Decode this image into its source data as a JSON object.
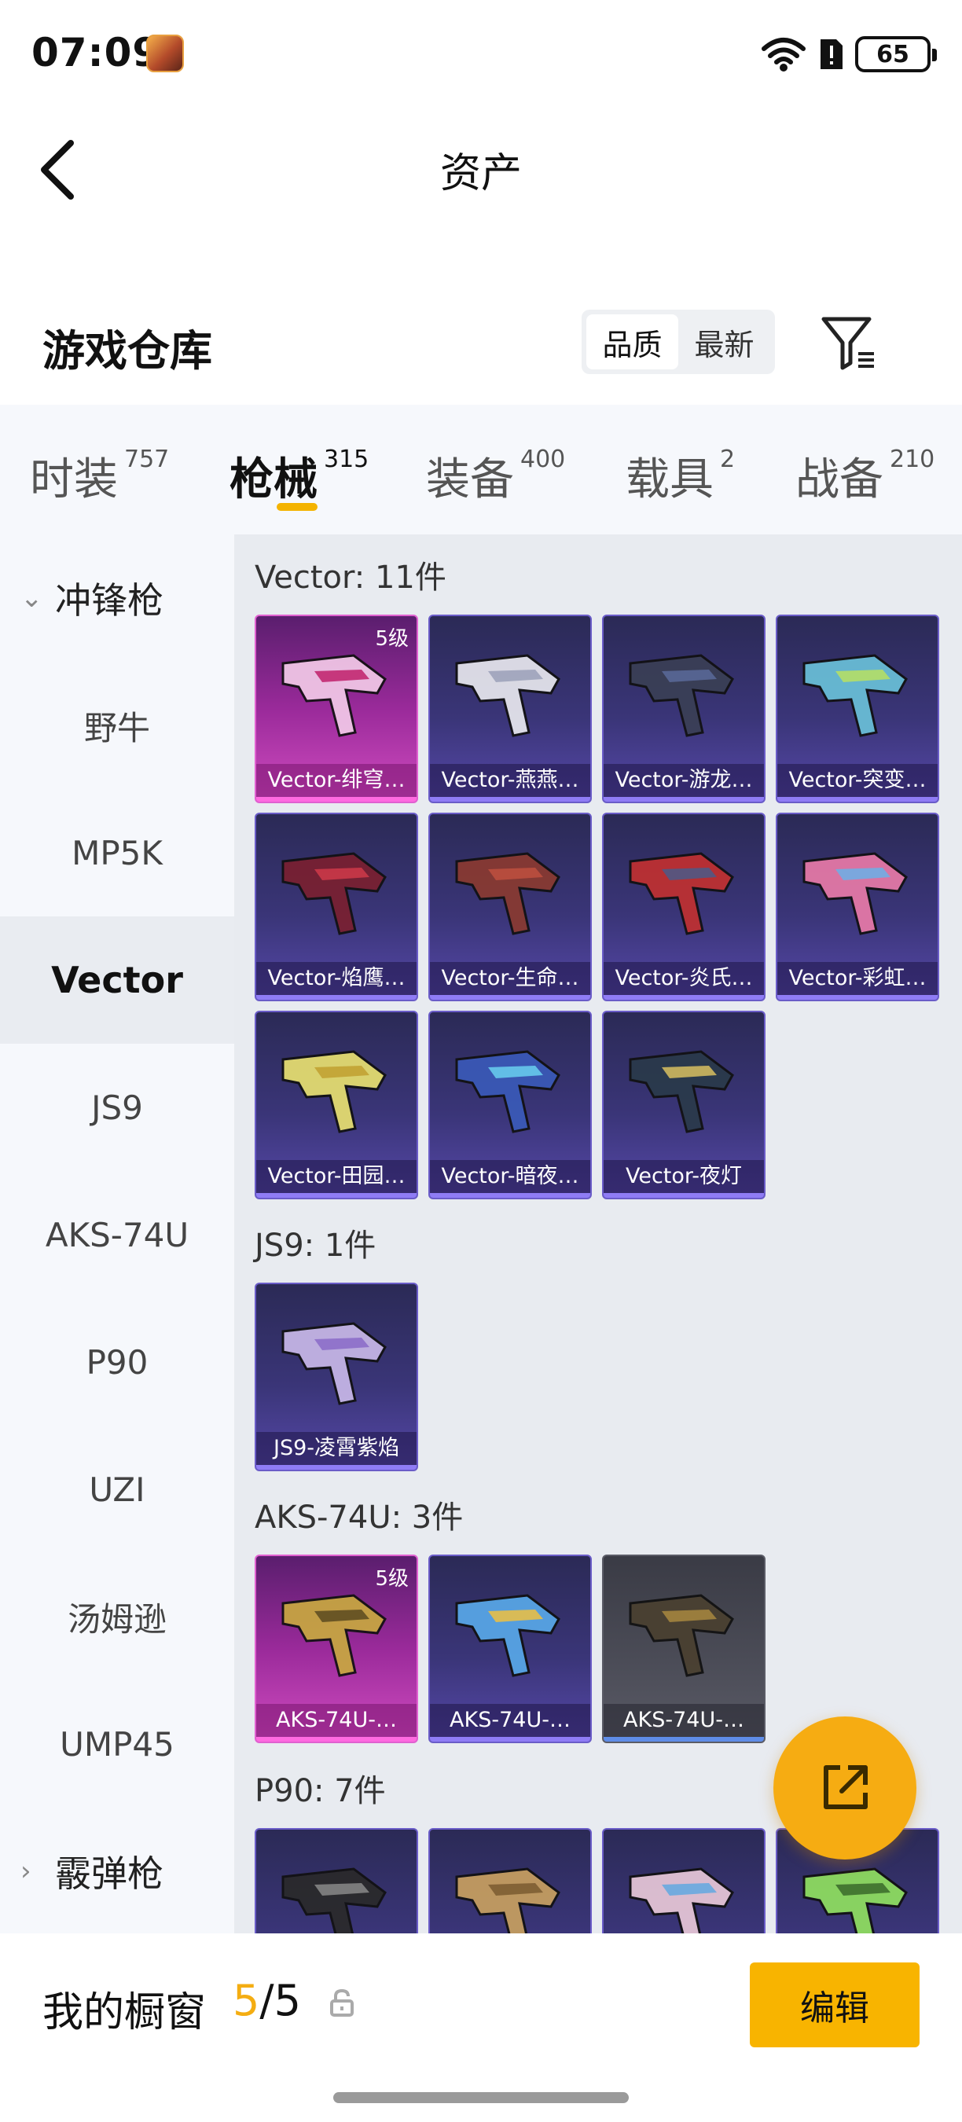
{
  "status": {
    "time": "07:09",
    "battery": "65"
  },
  "header": {
    "title": "资产"
  },
  "warehouse": {
    "title": "游戏仓库",
    "sort": [
      "品质",
      "最新"
    ]
  },
  "tabs": [
    {
      "label": "时装",
      "count": "757"
    },
    {
      "label": "枪械",
      "count": "315"
    },
    {
      "label": "装备",
      "count": "400"
    },
    {
      "label": "载具",
      "count": "2"
    },
    {
      "label": "战备",
      "count": "210"
    }
  ],
  "sidebar": {
    "group1": "冲锋枪",
    "items": [
      "野牛",
      "MP5K",
      "Vector",
      "JS9",
      "AKS-74U",
      "P90",
      "UZI",
      "汤姆逊",
      "UMP45"
    ],
    "group2": "霰弹枪"
  },
  "sections": [
    {
      "title": "Vector: 11件",
      "items": [
        {
          "label": "Vector-绯穹…",
          "level": "5级"
        },
        {
          "label": "Vector-燕燕…"
        },
        {
          "label": "Vector-游龙…"
        },
        {
          "label": "Vector-突变…"
        },
        {
          "label": "Vector-焰鹰…"
        },
        {
          "label": "Vector-生命…"
        },
        {
          "label": "Vector-炎氏…"
        },
        {
          "label": "Vector-彩虹…"
        },
        {
          "label": "Vector-田园…"
        },
        {
          "label": "Vector-暗夜…"
        },
        {
          "label": "Vector-夜灯"
        }
      ]
    },
    {
      "title": "JS9: 1件",
      "items": [
        {
          "label": "JS9-凌霄紫焰"
        }
      ]
    },
    {
      "title": "AKS-74U: 3件",
      "items": [
        {
          "label": "AKS-74U-…",
          "level": "5级"
        },
        {
          "label": "AKS-74U-…"
        },
        {
          "label": "AKS-74U-…"
        }
      ]
    },
    {
      "title": "P90: 7件"
    }
  ],
  "showcase": {
    "label": "我的橱窗",
    "current": "5",
    "separator": "/",
    "total": "5",
    "edit": "编辑"
  },
  "colors": {
    "accent": "#f8b400",
    "purple_card": "#3a3578",
    "lvl5_card": "#9a2a9a"
  }
}
